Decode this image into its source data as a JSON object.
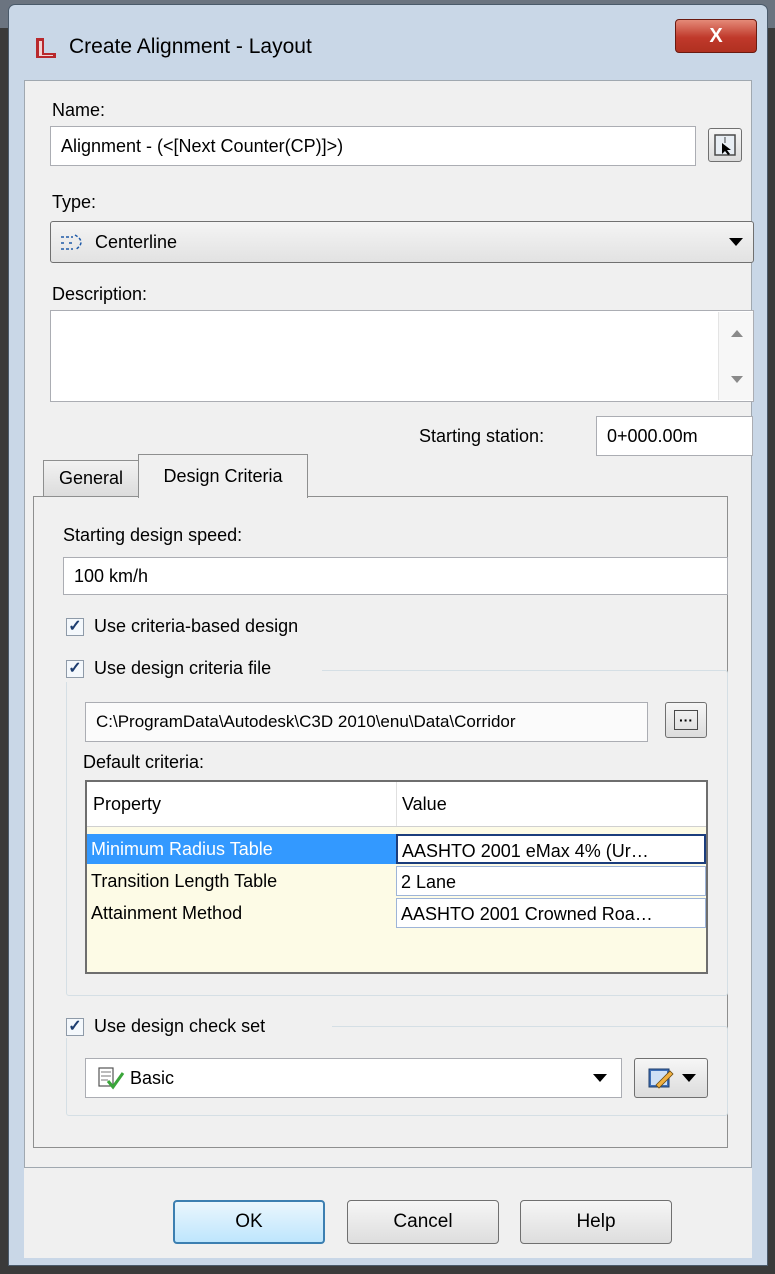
{
  "window": {
    "title": "Create Alignment - Layout",
    "close_label": "X"
  },
  "name": {
    "label": "Name:",
    "value": "Alignment - (<[Next Counter(CP)]>)"
  },
  "type": {
    "label": "Type:",
    "value": "Centerline"
  },
  "description": {
    "label": "Description:",
    "value": ""
  },
  "starting_station": {
    "label": "Starting station:",
    "value": "0+000.00m"
  },
  "tabs": [
    {
      "label": "General",
      "active": false
    },
    {
      "label": "Design Criteria",
      "active": true
    }
  ],
  "design_criteria": {
    "speed_label": "Starting design speed:",
    "speed_value": "100 km/h",
    "use_criteria_based_label": "Use criteria-based design",
    "use_criteria_based_checked": true,
    "use_criteria_file_label": "Use design criteria file",
    "use_criteria_file_checked": true,
    "criteria_file_path": "C:\\ProgramData\\Autodesk\\C3D 2010\\enu\\Data\\Corridor",
    "browse_label": "···",
    "default_criteria_label": "Default criteria:",
    "table": {
      "columns": [
        "Property",
        "Value"
      ],
      "rows": [
        {
          "property": "Minimum Radius Table",
          "value": "AASHTO 2001 eMax 4% (Ur…",
          "selected": true
        },
        {
          "property": "Transition Length Table",
          "value": "2 Lane",
          "selected": false
        },
        {
          "property": "Attainment Method",
          "value": "AASHTO 2001 Crowned Roa…",
          "selected": false
        }
      ]
    },
    "use_check_set_label": "Use design check set",
    "use_check_set_checked": true,
    "check_set_value": "Basic"
  },
  "buttons": {
    "ok": "OK",
    "cancel": "Cancel",
    "help": "Help"
  },
  "colors": {
    "selection": "#3399ff",
    "window_frame": "#c9d7e7",
    "close_button": "#c0392b"
  }
}
